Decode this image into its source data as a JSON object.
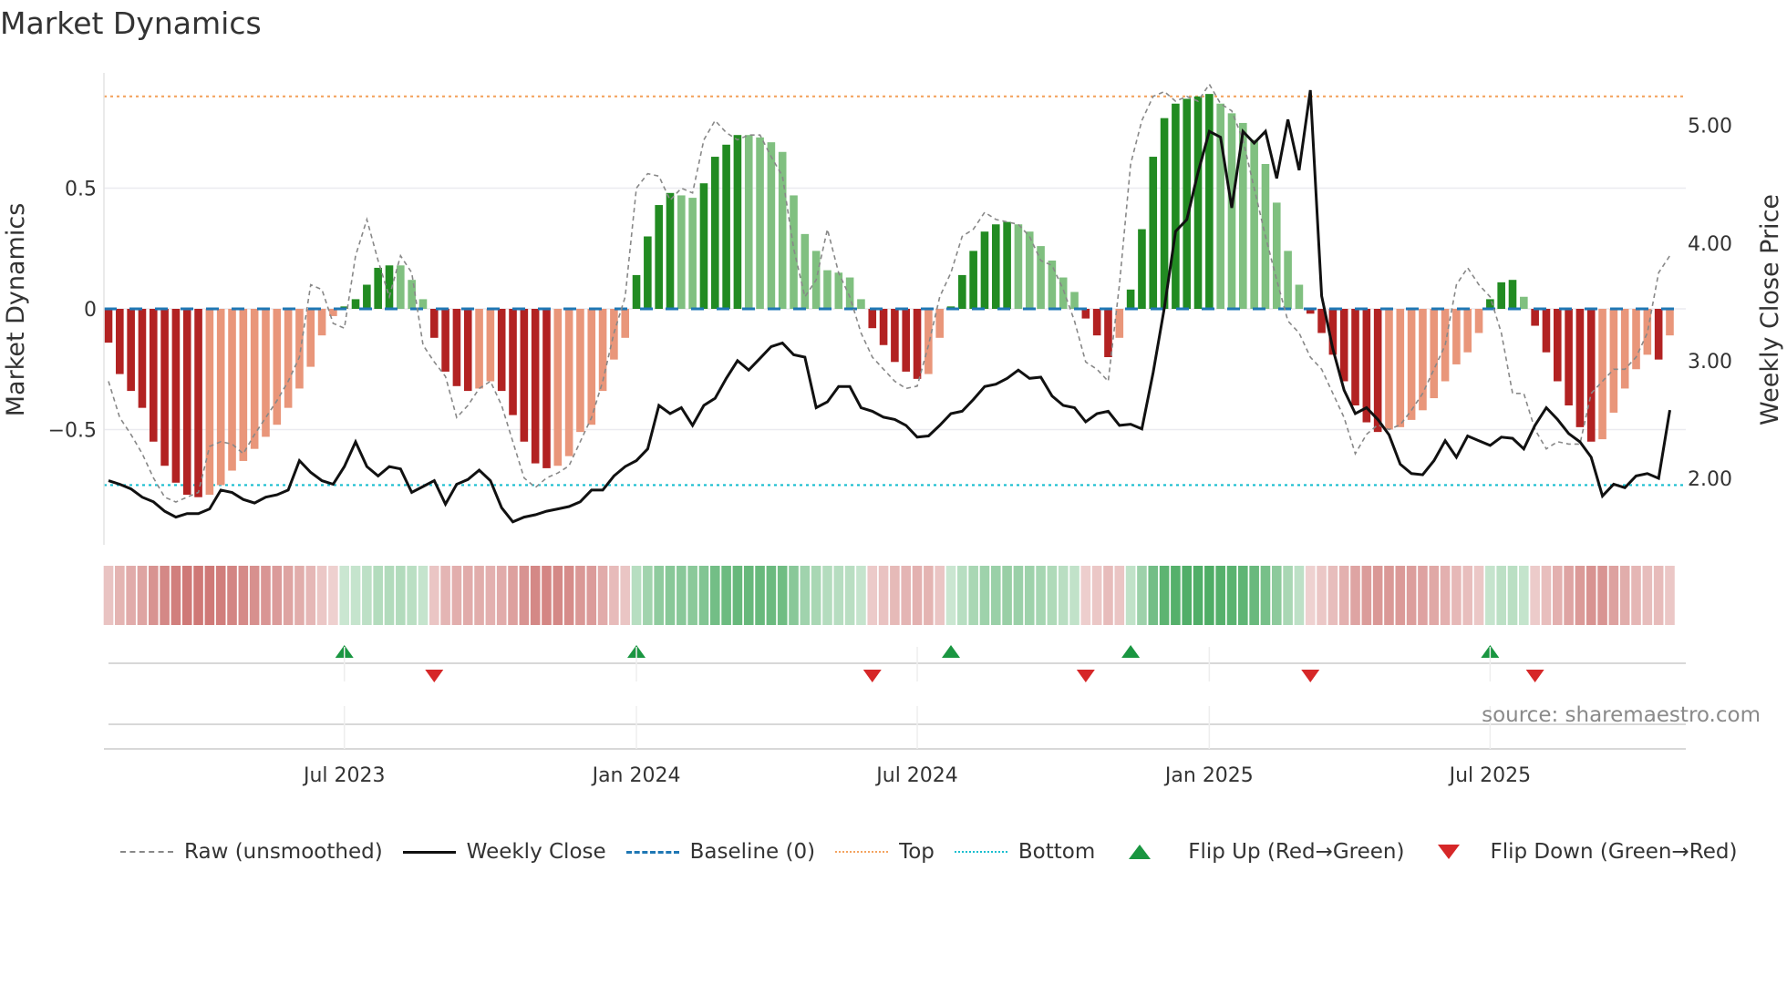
{
  "chart_data": {
    "type": "bar",
    "title": "Market Dynamics",
    "ylabel": "Market Dynamics",
    "y2label": "Weekly Close Price",
    "ylim": [
      -0.98,
      0.97
    ],
    "y2lim": [
      1.43,
      5.7
    ],
    "yticks": [
      {
        "v": 0.5,
        "label": "0.5"
      },
      {
        "v": 0,
        "label": "0"
      },
      {
        "v": -0.5,
        "label": "−0.5"
      }
    ],
    "y2ticks": [
      {
        "v": 5,
        "label": "5.00"
      },
      {
        "v": 4,
        "label": "4.00"
      },
      {
        "v": 3,
        "label": "3.00"
      },
      {
        "v": 2,
        "label": "2.00"
      }
    ],
    "xticks": [
      {
        "week": 21,
        "label": "Jul 2023"
      },
      {
        "week": 47,
        "label": "Jan 2024"
      },
      {
        "week": 72,
        "label": "Jul 2024"
      },
      {
        "week": 98,
        "label": "Jan 2025"
      },
      {
        "week": 123,
        "label": "Jul 2025"
      }
    ],
    "top_level": 0.88,
    "bottom_level": -0.73,
    "baseline": 0,
    "source": "source: sharemaestro.com",
    "colors": {
      "dark_red": "#b22222",
      "light_red": "#e9967a",
      "dark_green": "#228b22",
      "light_green": "#80c080",
      "top": "#f4a460",
      "bottom": "#17becf",
      "baseline": "#1f77b4",
      "up": "#1a9641",
      "down": "#d62728"
    },
    "momentum": [
      -0.14,
      -0.27,
      -0.34,
      -0.41,
      -0.55,
      -0.65,
      -0.72,
      -0.77,
      -0.78,
      -0.77,
      -0.73,
      -0.67,
      -0.63,
      -0.58,
      -0.53,
      -0.48,
      -0.41,
      -0.33,
      -0.24,
      -0.11,
      -0.03,
      0.01,
      0.04,
      0.1,
      0.17,
      0.18,
      0.18,
      0.12,
      0.04,
      -0.12,
      -0.26,
      -0.32,
      -0.34,
      -0.33,
      -0.3,
      -0.34,
      -0.44,
      -0.55,
      -0.64,
      -0.66,
      -0.65,
      -0.61,
      -0.51,
      -0.48,
      -0.34,
      -0.21,
      -0.12,
      0.14,
      0.3,
      0.43,
      0.48,
      0.47,
      0.46,
      0.52,
      0.63,
      0.68,
      0.72,
      0.72,
      0.71,
      0.69,
      0.65,
      0.47,
      0.31,
      0.24,
      0.16,
      0.15,
      0.13,
      0.04,
      -0.08,
      -0.15,
      -0.22,
      -0.26,
      -0.29,
      -0.27,
      -0.12,
      0.01,
      0.14,
      0.24,
      0.32,
      0.35,
      0.36,
      0.35,
      0.32,
      0.26,
      0.2,
      0.13,
      0.07,
      -0.04,
      -0.11,
      -0.2,
      -0.12,
      0.08,
      0.33,
      0.63,
      0.79,
      0.85,
      0.87,
      0.88,
      0.89,
      0.85,
      0.81,
      0.77,
      0.7,
      0.6,
      0.44,
      0.24,
      0.1,
      -0.02,
      -0.1,
      -0.19,
      -0.3,
      -0.4,
      -0.47,
      -0.51,
      -0.5,
      -0.49,
      -0.46,
      -0.42,
      -0.37,
      -0.3,
      -0.23,
      -0.18,
      -0.1,
      0.04,
      0.11,
      0.12,
      0.05,
      -0.07,
      -0.18,
      -0.3,
      -0.4,
      -0.49,
      -0.55,
      -0.54,
      -0.43,
      -0.33,
      -0.25,
      -0.19,
      -0.21,
      -0.11
    ],
    "raw": [
      -0.3,
      -0.45,
      -0.52,
      -0.6,
      -0.7,
      -0.78,
      -0.8,
      -0.78,
      -0.76,
      -0.57,
      -0.55,
      -0.56,
      -0.6,
      -0.52,
      -0.45,
      -0.38,
      -0.3,
      -0.2,
      0.1,
      0.08,
      -0.06,
      -0.08,
      0.22,
      0.37,
      0.2,
      0.05,
      0.22,
      0.15,
      -0.15,
      -0.22,
      -0.28,
      -0.45,
      -0.4,
      -0.33,
      -0.3,
      -0.4,
      -0.55,
      -0.7,
      -0.74,
      -0.7,
      -0.68,
      -0.65,
      -0.55,
      -0.45,
      -0.3,
      -0.1,
      0.05,
      0.5,
      0.56,
      0.55,
      0.45,
      0.5,
      0.48,
      0.7,
      0.78,
      0.73,
      0.7,
      0.72,
      0.72,
      0.63,
      0.55,
      0.25,
      0.05,
      0.12,
      0.33,
      0.15,
      0.05,
      -0.1,
      -0.2,
      -0.25,
      -0.3,
      -0.33,
      -0.32,
      -0.15,
      0.05,
      0.15,
      0.3,
      0.33,
      0.4,
      0.37,
      0.36,
      0.35,
      0.3,
      0.2,
      0.18,
      0.08,
      -0.05,
      -0.22,
      -0.25,
      -0.3,
      0.1,
      0.6,
      0.78,
      0.88,
      0.9,
      0.86,
      0.88,
      0.86,
      0.93,
      0.85,
      0.82,
      0.7,
      0.5,
      0.3,
      0.12,
      -0.05,
      -0.1,
      -0.2,
      -0.25,
      -0.35,
      -0.45,
      -0.6,
      -0.52,
      -0.48,
      -0.5,
      -0.48,
      -0.42,
      -0.35,
      -0.25,
      -0.15,
      0.1,
      0.17,
      0.1,
      0.05,
      -0.1,
      -0.35,
      -0.35,
      -0.5,
      -0.58,
      -0.55,
      -0.56,
      -0.56,
      -0.35,
      -0.3,
      -0.25,
      -0.25,
      -0.2,
      -0.1,
      0.15,
      0.22
    ],
    "close": [
      1.98,
      1.95,
      1.91,
      1.84,
      1.8,
      1.72,
      1.67,
      1.7,
      1.7,
      1.74,
      1.9,
      1.88,
      1.82,
      1.79,
      1.84,
      1.86,
      1.9,
      2.15,
      2.05,
      1.98,
      1.95,
      2.1,
      2.31,
      2.1,
      2.02,
      2.1,
      2.08,
      1.88,
      1.93,
      1.98,
      1.78,
      1.95,
      1.99,
      2.07,
      1.98,
      1.75,
      1.63,
      1.67,
      1.69,
      1.72,
      1.74,
      1.76,
      1.8,
      1.9,
      1.9,
      2.02,
      2.1,
      2.15,
      2.25,
      2.62,
      2.55,
      2.6,
      2.45,
      2.62,
      2.68,
      2.85,
      3.0,
      2.92,
      3.02,
      3.12,
      3.15,
      3.05,
      3.03,
      2.6,
      2.65,
      2.78,
      2.78,
      2.6,
      2.57,
      2.52,
      2.5,
      2.45,
      2.35,
      2.36,
      2.45,
      2.55,
      2.57,
      2.67,
      2.78,
      2.8,
      2.85,
      2.92,
      2.85,
      2.86,
      2.7,
      2.62,
      2.6,
      2.48,
      2.55,
      2.57,
      2.45,
      2.46,
      2.42,
      2.9,
      3.45,
      4.1,
      4.2,
      4.6,
      4.95,
      4.9,
      4.3,
      4.95,
      4.85,
      4.95,
      4.55,
      5.05,
      4.62,
      5.3,
      3.55,
      3.1,
      2.75,
      2.55,
      2.6,
      2.5,
      2.37,
      2.12,
      2.04,
      2.03,
      2.15,
      2.32,
      2.18,
      2.36,
      2.32,
      2.28,
      2.35,
      2.34,
      2.25,
      2.45,
      2.6,
      2.5,
      2.38,
      2.31,
      2.18,
      1.85,
      1.95,
      1.92,
      2.02,
      2.04,
      2.0,
      2.58
    ],
    "legend": {
      "raw": "Raw (unsmoothed)",
      "close": "Weekly Close",
      "baseline": "Baseline (0)",
      "top": "Top",
      "bottom": "Bottom",
      "flip_up": "Flip Up (Red→Green)",
      "flip_down": "Flip Down (Green→Red)"
    },
    "legend_position": "bottom"
  }
}
